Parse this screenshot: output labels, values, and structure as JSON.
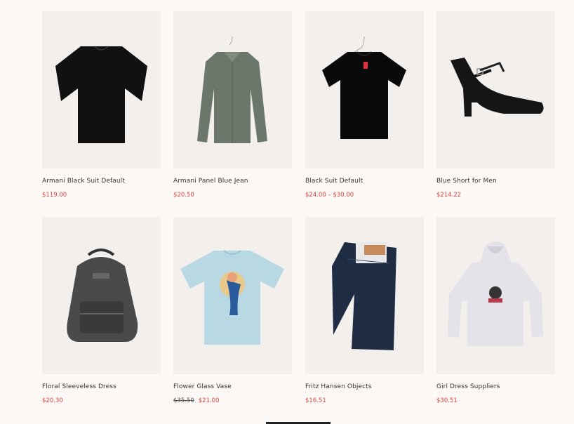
{
  "products": [
    {
      "name": "Armani Black Suit Default",
      "price": "$119.00",
      "image": "black-poncho-top"
    },
    {
      "name": "Armani Panel Blue Jean",
      "price": "$20.50",
      "image": "green-shirt"
    },
    {
      "name": "Black Suit Default",
      "price": "$24.00 – $30.00",
      "image": "black-tshirt"
    },
    {
      "name": "Blue Short for Men",
      "price": "$214.22",
      "image": "black-heels"
    },
    {
      "name": "Floral Sleeveless Dress",
      "price": "$20.30",
      "image": "gray-backpack"
    },
    {
      "name": "Flower Glass Vase",
      "old_price": "$35.50",
      "price": "$21.00",
      "image": "light-blue-tshirt"
    },
    {
      "name": "Fritz Hansen Objects",
      "price": "$16.51",
      "image": "denim-shorts"
    },
    {
      "name": "Girl Dress Suppliers",
      "price": "$30.51",
      "image": "white-hoodie"
    }
  ],
  "colors": {
    "background": "#fcf8f6",
    "card_bg": "#f3efed",
    "price": "#d9423a"
  }
}
